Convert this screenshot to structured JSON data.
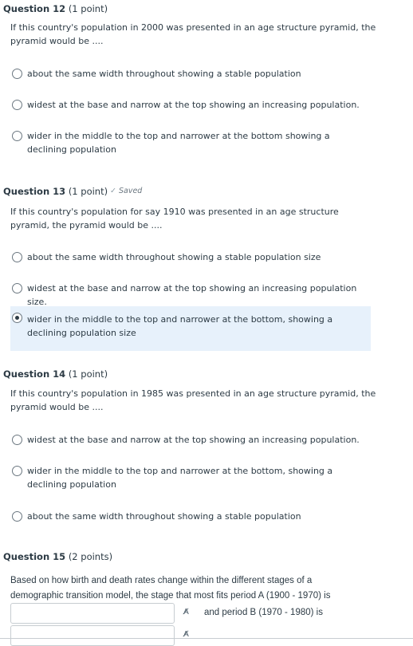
{
  "q12": {
    "number": "Question 12",
    "points": "(1 point)",
    "text": "If this country's population in 2000 was presented in an age structure pyramid, the pyramid would be ....",
    "options": [
      {
        "label": "about the same width throughout showing a stable population",
        "selected": false
      },
      {
        "label": "widest at the base and narrow at the top showing an increasing population.",
        "selected": false
      },
      {
        "label": "wider in the middle to the top and narrower at the bottom showing a declining population",
        "selected": false
      }
    ]
  },
  "q13": {
    "number": "Question 13",
    "points": "(1 point)",
    "saved": "Saved",
    "text": "If this country's population for say 1910 was presented in an age structure pyramid, the pyramid would be ....",
    "options": [
      {
        "label": "about the same width throughout showing a stable population size",
        "selected": false
      },
      {
        "label": "widest at the base and narrow at the top showing an increasing population size.",
        "selected": false
      },
      {
        "label": "wider in the middle to the top and narrower at the bottom, showing a declining population size",
        "selected": true
      }
    ]
  },
  "q14": {
    "number": "Question 14",
    "points": "(1 point)",
    "text": "If this country's population in 1985 was presented in an age structure pyramid, the pyramid would be ....",
    "options": [
      {
        "label": "widest at the base and narrow at the top showing an increasing population.",
        "selected": false
      },
      {
        "label": "wider in the middle to the top and narrower at the bottom, showing a declining population",
        "selected": false
      },
      {
        "label": "about the same width throughout showing a stable population",
        "selected": false
      }
    ]
  },
  "q15": {
    "number": "Question 15",
    "points": "(2 points)",
    "text": "Based on how birth and death rates change within the different stages of a demographic transition model, the stage that most fits period A (1900 - 1970) is",
    "blank1_value": "",
    "middle_text": "and period B (1970 - 1980) is",
    "blank2_value": ""
  },
  "colors": {
    "selected_bg": "#e7f1fb",
    "text": "#2d3b45"
  },
  "icons": {
    "saved": "check-icon",
    "spellcheck": "spellcheck-icon"
  }
}
